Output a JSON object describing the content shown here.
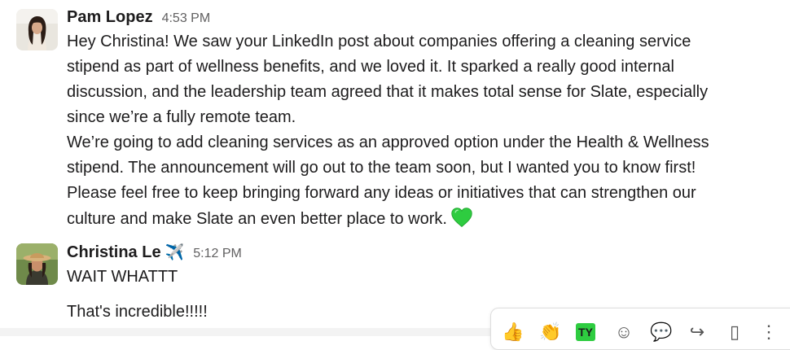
{
  "messages": [
    {
      "author": "Pam Lopez",
      "time": "4:53 PM",
      "avatar_icon": "user-photo-avatar",
      "lines": [
        "Hey Christina! We saw your LinkedIn post about companies offering a cleaning service",
        "stipend as part of wellness benefits, and we loved it. It sparked a really good internal",
        "discussion, and the leadership team agreed that it makes total sense for Slate, especially",
        "since we’re a fully remote team.",
        "We’re going to add cleaning services as an approved option under the Health & Wellness",
        "stipend. The announcement will go out to the team soon, but I wanted you to know first!",
        "Please feel free to keep bringing forward any ideas or initiatives that can strengthen our",
        "culture and make Slate an even better place to work."
      ],
      "emoji": "green-heart"
    },
    {
      "author": "Christina Le",
      "status_emoji": "✈️",
      "time": "5:12 PM",
      "avatar_icon": "user-photo-avatar",
      "lines": [
        "WAIT WHATTT"
      ]
    },
    {
      "lines": [
        "That's incredible!!!!!"
      ]
    }
  ],
  "hover_toolbar": {
    "buttons": [
      {
        "icon": "thumbs-up-icon",
        "glyph": "👍"
      },
      {
        "icon": "clap-icon",
        "glyph": "👏"
      },
      {
        "icon": "ty-emoji-icon",
        "glyph": "TY"
      },
      {
        "icon": "add-reaction-icon",
        "glyph": "☺"
      },
      {
        "icon": "reply-in-thread-icon",
        "glyph": "💬"
      },
      {
        "icon": "share-message-icon",
        "glyph": "↪"
      },
      {
        "icon": "save-for-later-icon",
        "glyph": "▯"
      },
      {
        "icon": "more-actions-icon",
        "glyph": "⋮"
      }
    ]
  },
  "colors": {
    "heart": "#2ecc40",
    "timestamp": "#616061",
    "text": "#1d1c1d"
  }
}
